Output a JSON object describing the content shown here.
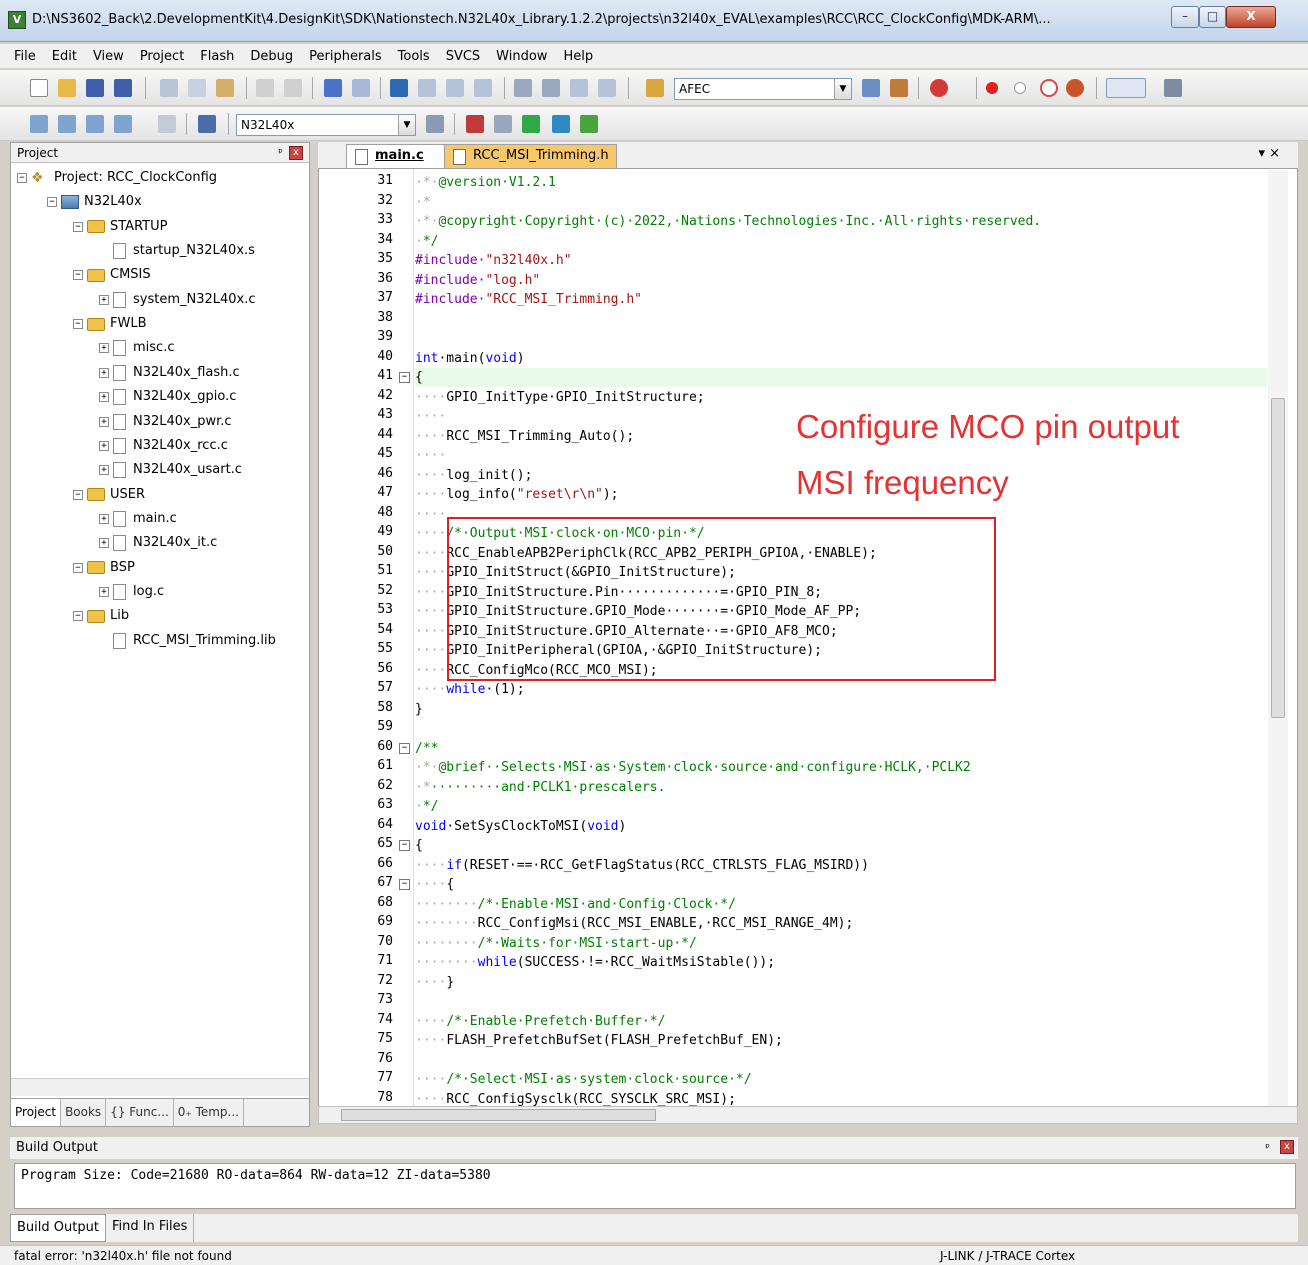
{
  "window": {
    "title": "D:\\NS3602_Back\\2.DevelopmentKit\\4.DesignKit\\SDK\\Nationstech.N32L40x_Library.1.2.2\\projects\\n32l40x_EVAL\\examples\\RCC\\RCC_ClockConfig\\MDK-ARM\\...",
    "app_icon": "uvision-icon",
    "min_label": "–",
    "max_label": "□",
    "close_label": "X"
  },
  "menu": [
    "File",
    "Edit",
    "View",
    "Project",
    "Flash",
    "Debug",
    "Peripherals",
    "Tools",
    "SVCS",
    "Window",
    "Help"
  ],
  "toolbar": {
    "find_combo_value": "AFEC",
    "target_combo_value": "N32L40x"
  },
  "project_panel": {
    "title": "Project",
    "pin": "ᵖ",
    "close": "x",
    "tree": [
      {
        "label": "Project: RCC_ClockConfig",
        "type": "project",
        "level": 0,
        "expander": "-"
      },
      {
        "label": "N32L40x",
        "type": "target",
        "level": 1,
        "expander": "-"
      },
      {
        "label": "STARTUP",
        "type": "folder",
        "level": 2,
        "expander": "-"
      },
      {
        "label": "startup_N32L40x.s",
        "type": "file",
        "level": 3,
        "expander": ""
      },
      {
        "label": "CMSIS",
        "type": "folder",
        "level": 2,
        "expander": "-"
      },
      {
        "label": "system_N32L40x.c",
        "type": "file",
        "level": 3,
        "expander": "+"
      },
      {
        "label": "FWLB",
        "type": "folder",
        "level": 2,
        "expander": "-"
      },
      {
        "label": "misc.c",
        "type": "file",
        "level": 3,
        "expander": "+"
      },
      {
        "label": "N32L40x_flash.c",
        "type": "file",
        "level": 3,
        "expander": "+"
      },
      {
        "label": "N32L40x_gpio.c",
        "type": "file",
        "level": 3,
        "expander": "+"
      },
      {
        "label": "N32L40x_pwr.c",
        "type": "file",
        "level": 3,
        "expander": "+"
      },
      {
        "label": "N32L40x_rcc.c",
        "type": "file",
        "level": 3,
        "expander": "+"
      },
      {
        "label": "N32L40x_usart.c",
        "type": "file",
        "level": 3,
        "expander": "+"
      },
      {
        "label": "USER",
        "type": "folder",
        "level": 2,
        "expander": "-"
      },
      {
        "label": "main.c",
        "type": "file",
        "level": 3,
        "expander": "+"
      },
      {
        "label": "N32L40x_it.c",
        "type": "file",
        "level": 3,
        "expander": "+"
      },
      {
        "label": "BSP",
        "type": "folder",
        "level": 2,
        "expander": "-"
      },
      {
        "label": "log.c",
        "type": "file",
        "level": 3,
        "expander": "+"
      },
      {
        "label": "Lib",
        "type": "folder",
        "level": 2,
        "expander": "-"
      },
      {
        "label": "RCC_MSI_Trimming.lib",
        "type": "file",
        "level": 3,
        "expander": ""
      }
    ],
    "tabs": [
      "Project",
      "Books",
      "{} Func...",
      "0₊ Temp..."
    ]
  },
  "editor": {
    "tabs": [
      "main.c",
      "RCC_MSI_Trimming.h"
    ],
    "tab_menu": "▾  ×",
    "annotation": [
      "Configure MCO pin output",
      "MSI frequency"
    ],
    "lines": [
      {
        "n": 31,
        "fold": "",
        "indent": "·*·",
        "segs": [
          [
            "cm",
            "@version·V1.2.1"
          ]
        ]
      },
      {
        "n": 32,
        "fold": "",
        "indent": "·*",
        "segs": []
      },
      {
        "n": 33,
        "fold": "",
        "indent": "·*·",
        "segs": [
          [
            "cm",
            "@copyright·Copyright·(c)·2022,·Nations·Technologies·Inc.·All·rights·reserved."
          ]
        ]
      },
      {
        "n": 34,
        "fold": "",
        "indent": "·",
        "segs": [
          [
            "cm",
            "*/"
          ]
        ]
      },
      {
        "n": 35,
        "fold": "",
        "indent": "",
        "segs": [
          [
            "pp",
            "#include·"
          ],
          [
            "st",
            "\"n32l40x.h\""
          ]
        ]
      },
      {
        "n": 36,
        "fold": "",
        "indent": "",
        "segs": [
          [
            "pp",
            "#include·"
          ],
          [
            "st",
            "\"log.h\""
          ]
        ]
      },
      {
        "n": 37,
        "fold": "",
        "indent": "",
        "segs": [
          [
            "pp",
            "#include·"
          ],
          [
            "st",
            "\"RCC_MSI_Trimming.h\""
          ]
        ]
      },
      {
        "n": 38,
        "fold": "",
        "indent": "",
        "segs": []
      },
      {
        "n": 39,
        "fold": "",
        "indent": "",
        "segs": []
      },
      {
        "n": 40,
        "fold": "",
        "indent": "",
        "segs": [
          [
            "kw",
            "int"
          ],
          [
            "",
            "·main("
          ],
          [
            "kw",
            "void"
          ],
          [
            "",
            ")"
          ]
        ]
      },
      {
        "n": 41,
        "fold": "-",
        "indent": "",
        "segs": [
          [
            "",
            "{"
          ]
        ]
      },
      {
        "n": 42,
        "fold": "",
        "indent": "····",
        "segs": [
          [
            "",
            "GPIO_InitType·GPIO_InitStructure;"
          ]
        ]
      },
      {
        "n": 43,
        "fold": "",
        "indent": "····",
        "segs": []
      },
      {
        "n": 44,
        "fold": "",
        "indent": "····",
        "segs": [
          [
            "",
            "RCC_MSI_Trimming_Auto();"
          ]
        ]
      },
      {
        "n": 45,
        "fold": "",
        "indent": "····",
        "segs": []
      },
      {
        "n": 46,
        "fold": "",
        "indent": "····",
        "segs": [
          [
            "",
            "log_init();"
          ]
        ]
      },
      {
        "n": 47,
        "fold": "",
        "indent": "····",
        "segs": [
          [
            "",
            "log_info("
          ],
          [
            "st",
            "\"reset\\r\\n\""
          ],
          [
            "",
            ");"
          ]
        ]
      },
      {
        "n": 48,
        "fold": "",
        "indent": "····",
        "segs": []
      },
      {
        "n": 49,
        "fold": "",
        "indent": "····",
        "segs": [
          [
            "cm",
            "/*·Output·MSI·clock·on·MCO·pin·*/"
          ]
        ]
      },
      {
        "n": 50,
        "fold": "",
        "indent": "····",
        "segs": [
          [
            "",
            "RCC_EnableAPB2PeriphClk(RCC_APB2_PERIPH_GPIOA,·ENABLE);"
          ]
        ]
      },
      {
        "n": 51,
        "fold": "",
        "indent": "····",
        "segs": [
          [
            "",
            "GPIO_InitStruct(&GPIO_InitStructure);"
          ]
        ]
      },
      {
        "n": 52,
        "fold": "",
        "indent": "····",
        "segs": [
          [
            "",
            "GPIO_InitStructure.Pin·············=·GPIO_PIN_8;"
          ]
        ]
      },
      {
        "n": 53,
        "fold": "",
        "indent": "····",
        "segs": [
          [
            "",
            "GPIO_InitStructure.GPIO_Mode·······=·GPIO_Mode_AF_PP;"
          ]
        ]
      },
      {
        "n": 54,
        "fold": "",
        "indent": "····",
        "segs": [
          [
            "",
            "GPIO_InitStructure.GPIO_Alternate··=·GPIO_AF8_MCO;"
          ]
        ]
      },
      {
        "n": 55,
        "fold": "",
        "indent": "····",
        "segs": [
          [
            "",
            "GPIO_InitPeripheral(GPIOA,·&GPIO_InitStructure);"
          ]
        ]
      },
      {
        "n": 56,
        "fold": "",
        "indent": "····",
        "segs": [
          [
            "",
            "RCC_ConfigMco(RCC_MCO_MSI);"
          ]
        ]
      },
      {
        "n": 57,
        "fold": "",
        "indent": "····",
        "segs": [
          [
            "kw",
            "while"
          ],
          [
            "",
            "·(1);"
          ]
        ]
      },
      {
        "n": 58,
        "fold": "",
        "indent": "",
        "segs": [
          [
            "",
            "}"
          ]
        ]
      },
      {
        "n": 59,
        "fold": "",
        "indent": "",
        "segs": []
      },
      {
        "n": 60,
        "fold": "-",
        "indent": "",
        "segs": [
          [
            "cm",
            "/**"
          ]
        ]
      },
      {
        "n": 61,
        "fold": "",
        "indent": "·*·",
        "segs": [
          [
            "cm",
            "@brief··Selects·MSI·as·System·clock·source·and·configure·HCLK,·PCLK2"
          ]
        ]
      },
      {
        "n": 62,
        "fold": "",
        "indent": "·*",
        "segs": [
          [
            "cm",
            "·········and·PCLK1·prescalers."
          ]
        ]
      },
      {
        "n": 63,
        "fold": "",
        "indent": "·",
        "segs": [
          [
            "cm",
            "*/"
          ]
        ]
      },
      {
        "n": 64,
        "fold": "",
        "indent": "",
        "segs": [
          [
            "kw",
            "void"
          ],
          [
            "",
            "·SetSysClockToMSI("
          ],
          [
            "kw",
            "void"
          ],
          [
            "",
            ")"
          ]
        ]
      },
      {
        "n": 65,
        "fold": "-",
        "indent": "",
        "segs": [
          [
            "",
            "{"
          ]
        ]
      },
      {
        "n": 66,
        "fold": "",
        "indent": "····",
        "segs": [
          [
            "kw",
            "if"
          ],
          [
            "",
            "(RESET·==·RCC_GetFlagStatus(RCC_CTRLSTS_FLAG_MSIRD))"
          ]
        ]
      },
      {
        "n": 67,
        "fold": "-",
        "indent": "····",
        "segs": [
          [
            "",
            "{"
          ]
        ]
      },
      {
        "n": 68,
        "fold": "",
        "indent": "········",
        "segs": [
          [
            "cm",
            "/*·Enable·MSI·and·Config·Clock·*/"
          ]
        ]
      },
      {
        "n": 69,
        "fold": "",
        "indent": "········",
        "segs": [
          [
            "",
            "RCC_ConfigMsi(RCC_MSI_ENABLE,·RCC_MSI_RANGE_4M);"
          ]
        ]
      },
      {
        "n": 70,
        "fold": "",
        "indent": "········",
        "segs": [
          [
            "cm",
            "/*·Waits·for·MSI·start-up·*/"
          ]
        ]
      },
      {
        "n": 71,
        "fold": "",
        "indent": "········",
        "segs": [
          [
            "kw",
            "while"
          ],
          [
            "",
            "(SUCCESS·!=·RCC_WaitMsiStable());"
          ]
        ]
      },
      {
        "n": 72,
        "fold": "",
        "indent": "····",
        "segs": [
          [
            "",
            "}"
          ]
        ]
      },
      {
        "n": 73,
        "fold": "",
        "indent": "",
        "segs": []
      },
      {
        "n": 74,
        "fold": "",
        "indent": "····",
        "segs": [
          [
            "cm",
            "/*·Enable·Prefetch·Buffer·*/"
          ]
        ]
      },
      {
        "n": 75,
        "fold": "",
        "indent": "····",
        "segs": [
          [
            "",
            "FLASH_PrefetchBufSet(FLASH_PrefetchBuf_EN);"
          ]
        ]
      },
      {
        "n": 76,
        "fold": "",
        "indent": "",
        "segs": []
      },
      {
        "n": 77,
        "fold": "",
        "indent": "····",
        "segs": [
          [
            "cm",
            "/*·Select·MSI·as·system·clock·source·*/"
          ]
        ]
      },
      {
        "n": 78,
        "fold": "",
        "indent": "····",
        "segs": [
          [
            "",
            "RCC_ConfigSysclk(RCC_SYSCLK_SRC_MSI);"
          ]
        ]
      }
    ]
  },
  "build": {
    "title": "Build Output",
    "pin": "ᵖ",
    "close": "x",
    "text": "Program Size: Code=21680 RO-data=864 RW-data=12 ZI-data=5380",
    "tabs": [
      "Build Output",
      "Find In Files"
    ]
  },
  "status": {
    "message": "fatal error: 'n32l40x.h' file not found",
    "debugger": "J-LINK / J-TRACE Cortex"
  },
  "colors": {
    "comment": "#008000",
    "preprocessor": "#8000b0",
    "keyword": "#0000ff",
    "string": "#a31515",
    "annotation": "#e53333",
    "active_tab": "#f7c76a"
  }
}
